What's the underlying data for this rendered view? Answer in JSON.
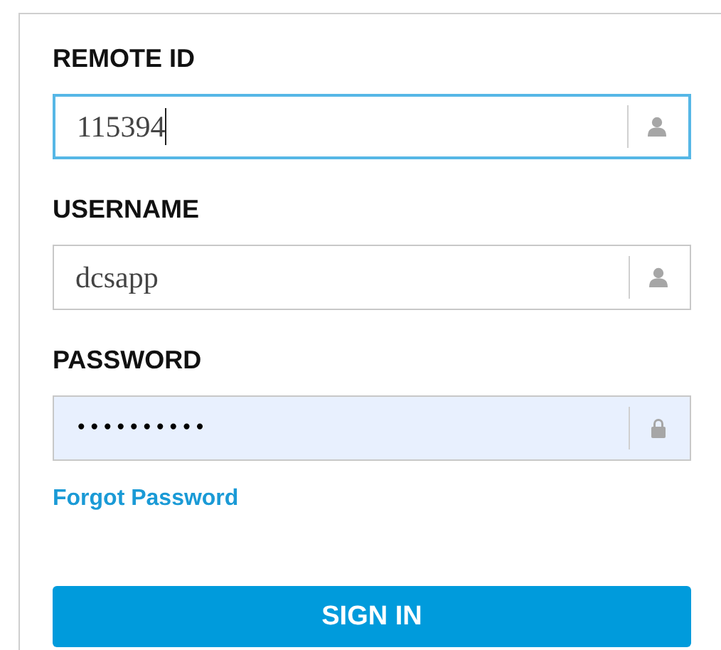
{
  "fields": [
    {
      "label": "REMOTE ID",
      "value": "115394",
      "kind": "text",
      "focused": true,
      "autofilled": false
    },
    {
      "label": "USERNAME",
      "value": "dcsapp",
      "kind": "text",
      "focused": false,
      "autofilled": false
    },
    {
      "label": "PASSWORD",
      "value": "••••••••••",
      "kind": "password",
      "focused": false,
      "autofilled": true
    }
  ],
  "forgot_link": "Forgot Password",
  "sign_in_button": "SIGN IN"
}
